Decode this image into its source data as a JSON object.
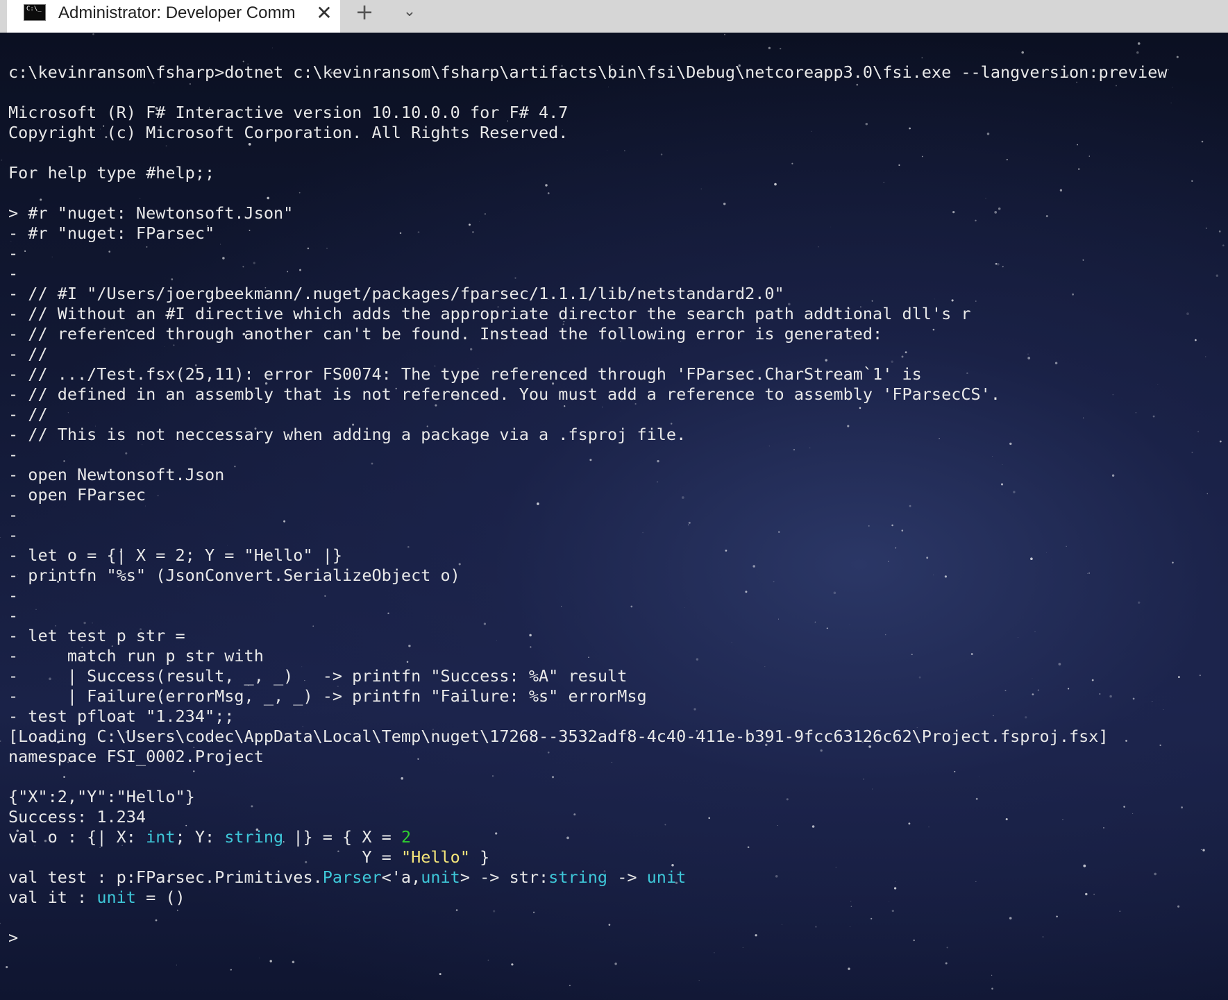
{
  "window": {
    "tab_title": "Administrator: Developer Comm",
    "tab_icon_glyph": "C:\\_",
    "close_glyph": "✕",
    "new_tab_glyph": "+",
    "dropdown_glyph": "⌄"
  },
  "colors": {
    "background": "#0d1224",
    "text": "#e8e8e8",
    "green": "#2fd12f",
    "cyan": "#3ec7d8",
    "yellow": "#f5e67a"
  },
  "console": {
    "lines": [
      [
        {
          "t": "c:\\kevinransom\\fsharp>dotnet c:\\kevinransom\\fsharp\\artifacts\\bin\\fsi\\Debug\\netcoreapp3.0\\fsi.exe --langversion:preview"
        }
      ],
      [
        {
          "t": ""
        }
      ],
      [
        {
          "t": "Microsoft (R) F# Interactive version 10.10.0.0 for F# 4.7"
        }
      ],
      [
        {
          "t": "Copyright (c) Microsoft Corporation. All Rights Reserved."
        }
      ],
      [
        {
          "t": ""
        }
      ],
      [
        {
          "t": "For help type #help;;"
        }
      ],
      [
        {
          "t": ""
        }
      ],
      [
        {
          "t": "> #r \"nuget: Newtonsoft.Json\""
        }
      ],
      [
        {
          "t": "- #r \"nuget: FParsec\""
        }
      ],
      [
        {
          "t": "-"
        }
      ],
      [
        {
          "t": "-"
        }
      ],
      [
        {
          "t": "- // #I \"/Users/joergbeekmann/.nuget/packages/fparsec/1.1.1/lib/netstandard2.0\""
        }
      ],
      [
        {
          "t": "- // Without an #I directive which adds the appropriate director the search path addtional dll's r"
        }
      ],
      [
        {
          "t": "- // referenced through another can't be found. Instead the following error is generated:"
        }
      ],
      [
        {
          "t": "- //"
        }
      ],
      [
        {
          "t": "- // .../Test.fsx(25,11): error FS0074: The type referenced through 'FParsec.CharStream`1' is"
        }
      ],
      [
        {
          "t": "- // defined in an assembly that is not referenced. You must add a reference to assembly 'FParsecCS'."
        }
      ],
      [
        {
          "t": "- //"
        }
      ],
      [
        {
          "t": "- // This is not neccessary when adding a package via a .fsproj file."
        }
      ],
      [
        {
          "t": "-"
        }
      ],
      [
        {
          "t": "- open Newtonsoft.Json"
        }
      ],
      [
        {
          "t": "- open FParsec"
        }
      ],
      [
        {
          "t": "-"
        }
      ],
      [
        {
          "t": "-"
        }
      ],
      [
        {
          "t": "- let o = {| X = 2; Y = \"Hello\" |}"
        }
      ],
      [
        {
          "t": "- printfn \"%s\" (JsonConvert.SerializeObject o)"
        }
      ],
      [
        {
          "t": "-"
        }
      ],
      [
        {
          "t": "-"
        }
      ],
      [
        {
          "t": "- let test p str ="
        }
      ],
      [
        {
          "t": "-     match run p str with"
        }
      ],
      [
        {
          "t": "-     | Success(result, _, _)   -> printfn \"Success: %A\" result"
        }
      ],
      [
        {
          "t": "-     | Failure(errorMsg, _, _) -> printfn \"Failure: %s\" errorMsg"
        }
      ],
      [
        {
          "t": "- test pfloat \"1.234\";;"
        }
      ],
      [
        {
          "t": "[Loading C:\\Users\\codec\\AppData\\Local\\Temp\\nuget\\17268--3532adf8-4c40-411e-b391-9fcc63126c62\\Project.fsproj.fsx]"
        }
      ],
      [
        {
          "t": "namespace FSI_0002.Project"
        }
      ],
      [
        {
          "t": ""
        }
      ],
      [
        {
          "t": "{\"X\":2,\"Y\":\"Hello\"}"
        }
      ],
      [
        {
          "t": "Success: 1.234"
        }
      ],
      [
        {
          "t": "val o : {| X: "
        },
        {
          "t": "int",
          "c": "cyan"
        },
        {
          "t": "; Y: "
        },
        {
          "t": "string",
          "c": "cyan"
        },
        {
          "t": " |} = { X = "
        },
        {
          "t": "2",
          "c": "green"
        }
      ],
      [
        {
          "t": "                                    Y = "
        },
        {
          "t": "\"Hello\"",
          "c": "yellow"
        },
        {
          "t": " }"
        }
      ],
      [
        {
          "t": "val test : p:FParsec.Primitives."
        },
        {
          "t": "Parser",
          "c": "cyan"
        },
        {
          "t": "<'a,"
        },
        {
          "t": "unit",
          "c": "cyan"
        },
        {
          "t": "> -> str:"
        },
        {
          "t": "string",
          "c": "cyan"
        },
        {
          "t": " -> "
        },
        {
          "t": "unit",
          "c": "cyan"
        }
      ],
      [
        {
          "t": "val it : "
        },
        {
          "t": "unit",
          "c": "cyan"
        },
        {
          "t": " = ()"
        }
      ],
      [
        {
          "t": ""
        }
      ],
      [
        {
          "t": ">"
        }
      ]
    ]
  }
}
